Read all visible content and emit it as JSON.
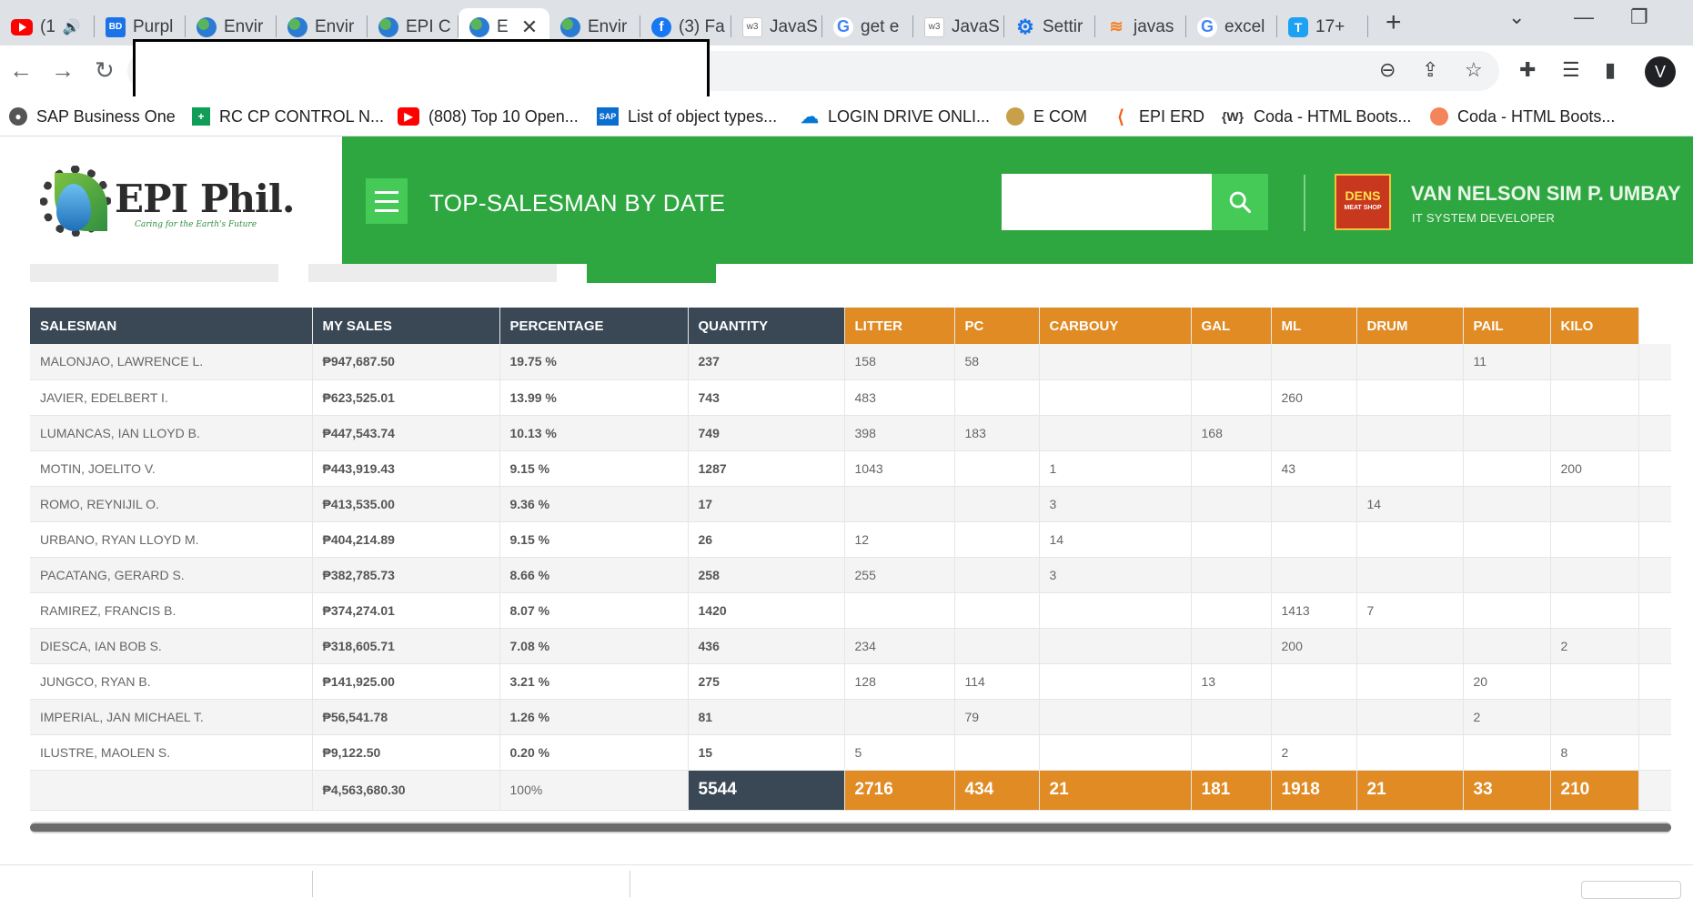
{
  "browser": {
    "tabs": [
      {
        "label": "(1",
        "icon": "youtube-icon"
      },
      {
        "label": "Purpl",
        "icon": "bd-icon"
      },
      {
        "label": "Envir",
        "icon": "globe-icon"
      },
      {
        "label": "Envir",
        "icon": "globe-icon"
      },
      {
        "label": "EPI C",
        "icon": "globe-icon"
      },
      {
        "label": "E",
        "icon": "globe-icon"
      },
      {
        "label": "Envir",
        "icon": "globe-icon"
      },
      {
        "label": "(3) Fa",
        "icon": "facebook-icon"
      },
      {
        "label": "JavaS",
        "icon": "w3schools-icon"
      },
      {
        "label": "get e",
        "icon": "google-icon"
      },
      {
        "label": "JavaS",
        "icon": "w3schools-icon"
      },
      {
        "label": "Settir",
        "icon": "gear-icon"
      },
      {
        "label": "javas",
        "icon": "stackoverflow-icon"
      },
      {
        "label": "excel",
        "icon": "google-icon"
      },
      {
        "label": "17+",
        "icon": "t-icon"
      }
    ],
    "profile_initial": "V",
    "bookmarks": [
      {
        "label": "SAP Business One",
        "icon": "globe-icon"
      },
      {
        "label": "RC CP CONTROL N...",
        "icon": "sheets-icon"
      },
      {
        "label": "(808) Top 10 Open...",
        "icon": "youtube-icon"
      },
      {
        "label": "List of object types...",
        "icon": "sap-icon"
      },
      {
        "label": "LOGIN DRIVE ONLI...",
        "icon": "onedrive-icon"
      },
      {
        "label": "E COM",
        "icon": "coin-icon"
      },
      {
        "label": "EPI ERD",
        "icon": "erd-icon"
      },
      {
        "label": "Coda - HTML Boots...",
        "icon": "w-icon"
      },
      {
        "label": "Coda - HTML Boots...",
        "icon": "coda-icon"
      }
    ]
  },
  "header": {
    "logo_text": "EPI Phil.",
    "logo_tagline": "Caring for the Earth's Future",
    "title": "TOP-SALESMAN BY DATE",
    "search_value": "",
    "avatar_text": "DENS",
    "avatar_sub": "MEAT SHOP",
    "user_name": "VAN NELSON SIM P. UMBAY",
    "user_role": "IT SYSTEM DEVELOPER"
  },
  "table": {
    "headers": [
      "SALESMAN",
      "MY SALES",
      "PERCENTAGE",
      "QUANTITY",
      "LITTER",
      "PC",
      "CARBOUY",
      "GAL",
      "ML",
      "DRUM",
      "PAIL",
      "KILO"
    ],
    "rows": [
      [
        "MALONJAO, LAWRENCE L.",
        "₱947,687.50",
        "19.75 %",
        "237",
        "158",
        "58",
        "",
        "",
        "",
        "",
        "11",
        ""
      ],
      [
        "JAVIER, EDELBERT I.",
        "₱623,525.01",
        "13.99 %",
        "743",
        "483",
        "",
        "",
        "",
        "260",
        "",
        "",
        ""
      ],
      [
        "LUMANCAS, IAN LLOYD B.",
        "₱447,543.74",
        "10.13 %",
        "749",
        "398",
        "183",
        "",
        "168",
        "",
        "",
        "",
        ""
      ],
      [
        "MOTIN, JOELITO V.",
        "₱443,919.43",
        "9.15 %",
        "1287",
        "1043",
        "",
        "1",
        "",
        "43",
        "",
        "",
        "200"
      ],
      [
        "ROMO, REYNIJIL O.",
        "₱413,535.00",
        "9.36 %",
        "17",
        "",
        "",
        "3",
        "",
        "",
        "14",
        "",
        ""
      ],
      [
        "URBANO, RYAN LLOYD M.",
        "₱404,214.89",
        "9.15 %",
        "26",
        "12",
        "",
        "14",
        "",
        "",
        "",
        "",
        ""
      ],
      [
        "PACATANG, GERARD S.",
        "₱382,785.73",
        "8.66 %",
        "258",
        "255",
        "",
        "3",
        "",
        "",
        "",
        "",
        ""
      ],
      [
        "RAMIREZ, FRANCIS B.",
        "₱374,274.01",
        "8.07 %",
        "1420",
        "",
        "",
        "",
        "",
        "1413",
        "7",
        "",
        ""
      ],
      [
        "DIESCA, IAN BOB S.",
        "₱318,605.71",
        "7.08 %",
        "436",
        "234",
        "",
        "",
        "",
        "200",
        "",
        "",
        "2"
      ],
      [
        "JUNGCO, RYAN B.",
        "₱141,925.00",
        "3.21 %",
        "275",
        "128",
        "114",
        "",
        "13",
        "",
        "",
        "20",
        ""
      ],
      [
        "IMPERIAL, JAN MICHAEL T.",
        "₱56,541.78",
        "1.26 %",
        "81",
        "",
        "79",
        "",
        "",
        "",
        "",
        "2",
        ""
      ],
      [
        "ILUSTRE, MAOLEN S.",
        "₱9,122.50",
        "0.20 %",
        "15",
        "5",
        "",
        "",
        "",
        "2",
        "",
        "",
        "8"
      ]
    ],
    "totals": [
      "",
      "₱4,563,680.30",
      "100%",
      "5544",
      "2716",
      "434",
      "21",
      "181",
      "1918",
      "21",
      "33",
      "210"
    ]
  },
  "colors": {
    "accent_green": "#2ea740",
    "header_dark": "#3a4856",
    "header_orange": "#e08b24"
  }
}
